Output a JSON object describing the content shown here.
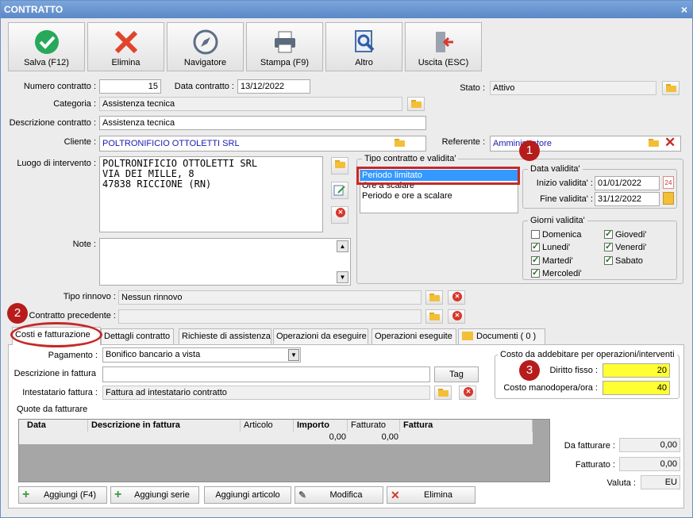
{
  "window": {
    "title": "CONTRATTO"
  },
  "toolbar": {
    "save": "Salva (F12)",
    "delete": "Elimina",
    "navigator": "Navigatore",
    "print": "Stampa (F9)",
    "other": "Altro",
    "exit": "Uscita (ESC)"
  },
  "header": {
    "numero_label": "Numero contratto :",
    "numero_value": "15",
    "data_label": "Data contratto :",
    "data_value": "13/12/2022",
    "stato_label": "Stato :",
    "stato_value": "Attivo",
    "categoria_label": "Categoria :",
    "categoria_value": "Assistenza tecnica",
    "descrizione_label": "Descrizione contratto :",
    "descrizione_value": "Assistenza tecnica",
    "cliente_label": "Cliente :",
    "cliente_value": "POLTRONIFICIO OTTOLETTI SRL",
    "referente_label": "Referente :",
    "referente_value": "Amministratore",
    "luogo_label": "Luogo di intervento :",
    "luogo_lines": [
      "POLTRONIFICIO OTTOLETTI SRL",
      "VIA DEI MILLE, 8",
      "47838 RICCIONE (RN)"
    ],
    "note_label": "Note :",
    "tipo_rinnovo_label": "Tipo rinnovo :",
    "tipo_rinnovo_value": "Nessun rinnovo",
    "precedente_label": "Contratto precedente :"
  },
  "tipo_contratto": {
    "title": "Tipo contratto e validita'",
    "options": [
      "Periodo limitato",
      "Ore a scalare",
      "Periodo e ore a scalare"
    ],
    "selected": "Periodo limitato"
  },
  "data_validita": {
    "title": "Data validita'",
    "inizio_label": "Inizio validita' :",
    "inizio_value": "01/01/2022",
    "fine_label": "Fine validita' :",
    "fine_value": "31/12/2022"
  },
  "giorni_validita": {
    "title": "Giorni validita'",
    "days": {
      "domenica": {
        "label": "Domenica",
        "checked": false
      },
      "lunedi": {
        "label": "Lunedi'",
        "checked": true
      },
      "martedi": {
        "label": "Martedi'",
        "checked": true
      },
      "mercoledi": {
        "label": "Mercoledi'",
        "checked": true
      },
      "giovedi": {
        "label": "Giovedi'",
        "checked": true
      },
      "venerdi": {
        "label": "Venerdi'",
        "checked": true
      },
      "sabato": {
        "label": "Sabato",
        "checked": true
      }
    }
  },
  "badges": {
    "one": "1",
    "two": "2",
    "three": "3"
  },
  "tabs": [
    "Costi e fatturazione",
    "Dettagli contratto",
    "Richieste di assistenza",
    "Operazioni da eseguire",
    "Operazioni eseguite",
    "Documenti ( 0 )"
  ],
  "billing": {
    "pagamento_label": "Pagamento :",
    "pagamento_value": "Bonifico bancario a vista",
    "descrizione_label": "Descrizione in fattura",
    "descrizione_value": "",
    "tag_button": "Tag",
    "intestatario_label": "Intestatario fattura :",
    "intestatario_value": "Fattura ad intestatario contratto",
    "quote_label": "Quote da fatturare"
  },
  "costo": {
    "title": "Costo da addebitare per operazioni/interventi",
    "diritto_label": "Diritto fisso :",
    "diritto_value": "20",
    "manodopera_label": "Costo manodopera/ora :",
    "manodopera_value": "40"
  },
  "table": {
    "columns": [
      "Data",
      "Descrizione in fattura",
      "Articolo",
      "Importo",
      "Fatturato",
      "Fattura"
    ],
    "totals": {
      "importo": "0,00",
      "fatturato": "0,00"
    }
  },
  "summary": {
    "da_fatturare_label": "Da fatturare :",
    "da_fatturare_value": "0,00",
    "fatturato_label": "Fatturato :",
    "fatturato_value": "0,00",
    "valuta_label": "Valuta :",
    "valuta_value": "EU"
  },
  "bottom_buttons": {
    "add": "Aggiungi (F4)",
    "add_series": "Aggiungi serie",
    "add_article": "Aggiungi articolo",
    "edit": "Modifica",
    "delete": "Elimina"
  },
  "colors": {
    "accent_red": "#b71c1c",
    "highlight_yellow": "#ffff33",
    "selection_blue": "#3399ff"
  }
}
